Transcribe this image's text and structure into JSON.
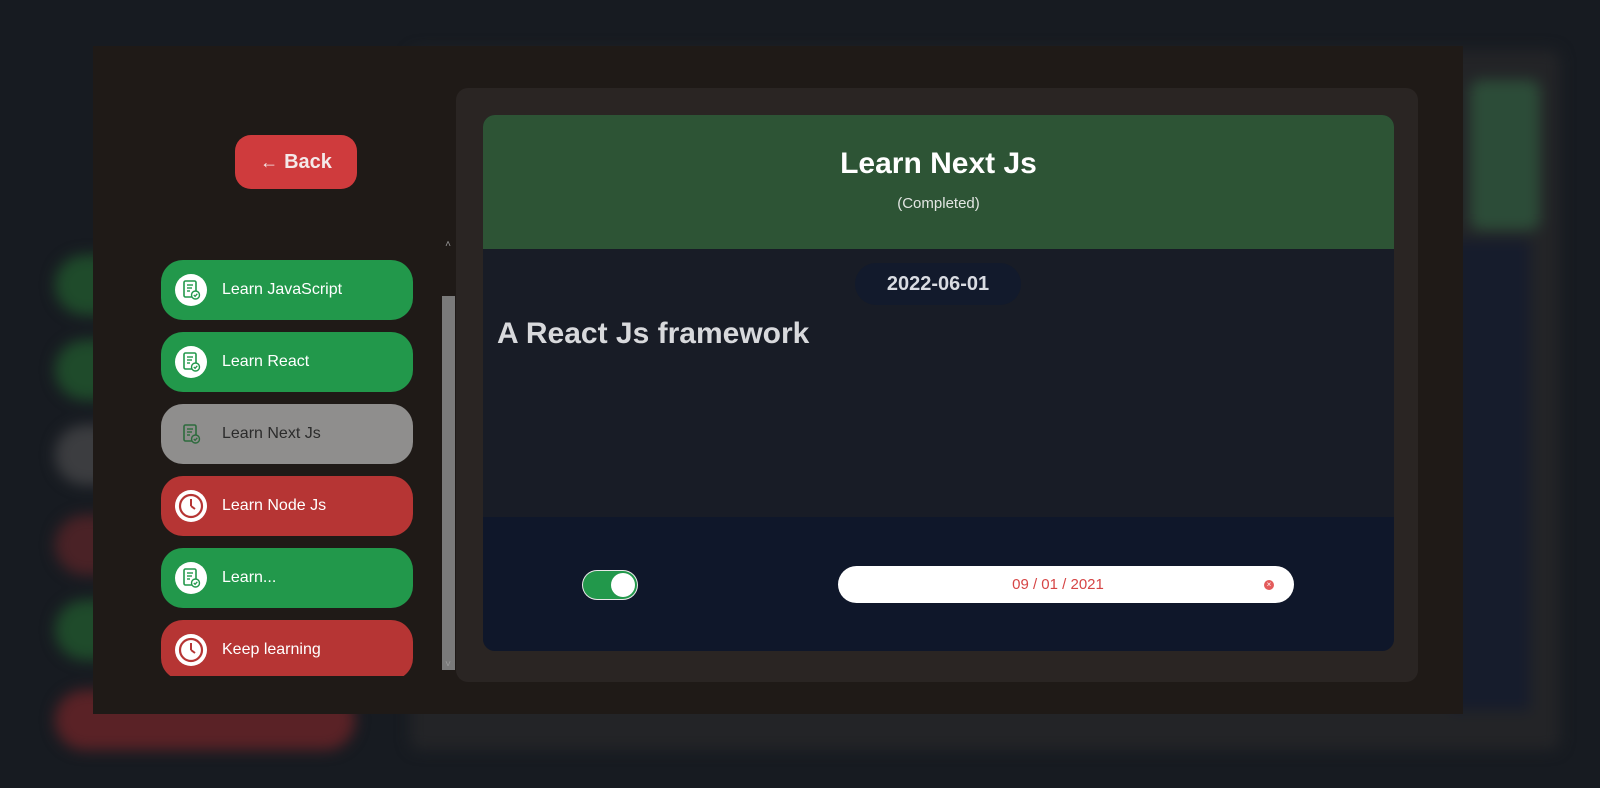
{
  "back_button": {
    "label": "Back",
    "icon": "arrow-left-icon"
  },
  "tasks": [
    {
      "label": "Learn JavaScript",
      "status": "completed",
      "icon": "task-check-icon"
    },
    {
      "label": "Learn React",
      "status": "completed",
      "icon": "task-check-icon"
    },
    {
      "label": "Learn Next Js",
      "status": "selected",
      "icon": "task-check-icon"
    },
    {
      "label": "Learn Node Js",
      "status": "pending",
      "icon": "clock-icon"
    },
    {
      "label": "Learn...",
      "status": "completed",
      "icon": "task-check-icon"
    },
    {
      "label": "Keep learning",
      "status": "pending",
      "icon": "clock-icon"
    }
  ],
  "detail": {
    "title": "Learn Next Js",
    "status": "(Completed)",
    "date": "2022-06-01",
    "description": "A React Js framework",
    "completed_toggle": true,
    "date_input": {
      "month": "09",
      "day": "01",
      "year": "2021",
      "display": "09 / 01 / 2021"
    }
  },
  "colors": {
    "completed": "#22984b",
    "pending": "#b63534",
    "selected": "#8f8e8d",
    "header": "#2d5435",
    "back_button": "#cf3b3d"
  }
}
